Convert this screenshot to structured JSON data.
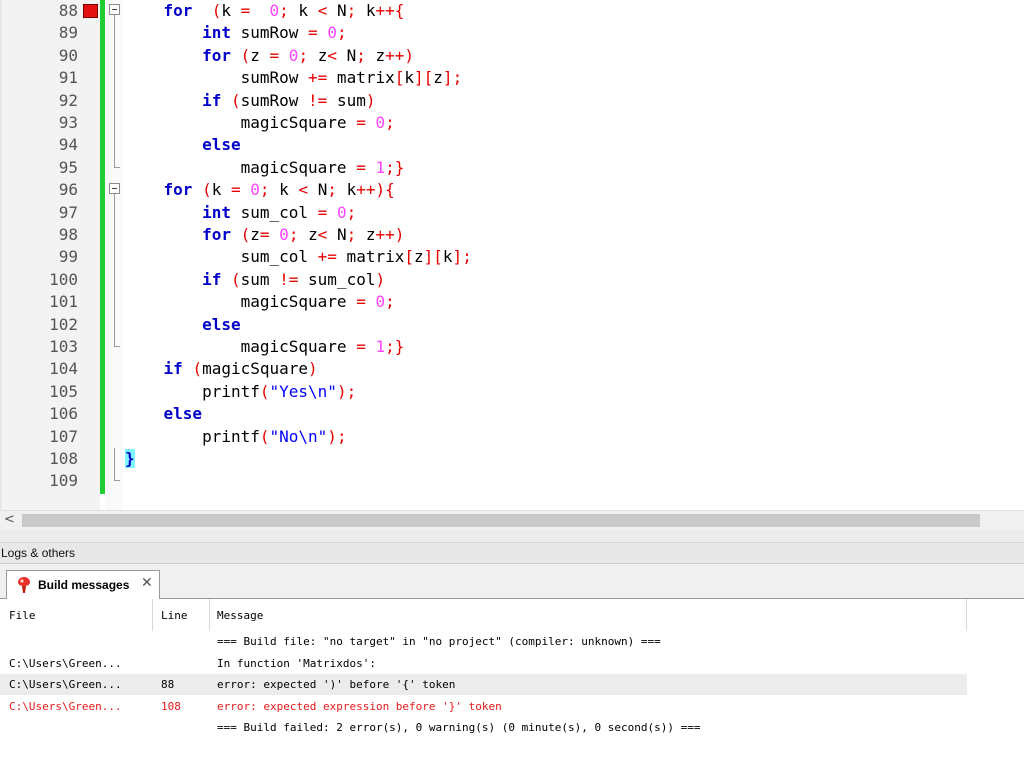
{
  "editor": {
    "lines": [
      {
        "num": "88"
      },
      {
        "num": "89"
      },
      {
        "num": "90"
      },
      {
        "num": "91"
      },
      {
        "num": "92"
      },
      {
        "num": "93"
      },
      {
        "num": "94"
      },
      {
        "num": "95"
      },
      {
        "num": "96"
      },
      {
        "num": "97"
      },
      {
        "num": "98"
      },
      {
        "num": "99"
      },
      {
        "num": "100"
      },
      {
        "num": "101"
      },
      {
        "num": "102"
      },
      {
        "num": "103"
      },
      {
        "num": "104"
      },
      {
        "num": "105"
      },
      {
        "num": "106"
      },
      {
        "num": "107"
      },
      {
        "num": "108"
      },
      {
        "num": "109"
      }
    ],
    "code": [
      [
        [
          "kw",
          "    for"
        ],
        [
          "",
          "  "
        ],
        [
          "op",
          "("
        ],
        [
          "",
          "k "
        ],
        [
          "op",
          "="
        ],
        [
          "",
          "  "
        ],
        [
          "num",
          "0"
        ],
        [
          "op",
          ";"
        ],
        [
          "",
          " k "
        ],
        [
          "op",
          "<"
        ],
        [
          "",
          " N"
        ],
        [
          "op",
          ";"
        ],
        [
          "",
          " k"
        ],
        [
          "op",
          "++"
        ],
        [
          "op",
          "{"
        ]
      ],
      [
        [
          "",
          "        "
        ],
        [
          "kw",
          "int"
        ],
        [
          "",
          " sumRow "
        ],
        [
          "op",
          "="
        ],
        [
          "",
          " "
        ],
        [
          "num",
          "0"
        ],
        [
          "op",
          ";"
        ]
      ],
      [
        [
          "",
          "        "
        ],
        [
          "kw",
          "for"
        ],
        [
          "",
          " "
        ],
        [
          "op",
          "("
        ],
        [
          "",
          "z "
        ],
        [
          "op",
          "="
        ],
        [
          "",
          " "
        ],
        [
          "num",
          "0"
        ],
        [
          "op",
          ";"
        ],
        [
          "",
          " z"
        ],
        [
          "op",
          "<"
        ],
        [
          "",
          " N"
        ],
        [
          "op",
          ";"
        ],
        [
          "",
          " z"
        ],
        [
          "op",
          "++"
        ],
        [
          "op",
          ")"
        ]
      ],
      [
        [
          "",
          "            sumRow "
        ],
        [
          "op",
          "+="
        ],
        [
          "",
          " matrix"
        ],
        [
          "op",
          "["
        ],
        [
          "",
          "k"
        ],
        [
          "op",
          "]["
        ],
        [
          "",
          "z"
        ],
        [
          "op",
          "]"
        ],
        [
          "op",
          ";"
        ]
      ],
      [
        [
          "",
          "        "
        ],
        [
          "kw",
          "if"
        ],
        [
          "",
          " "
        ],
        [
          "op",
          "("
        ],
        [
          "",
          "sumRow "
        ],
        [
          "op",
          "!="
        ],
        [
          "",
          " sum"
        ],
        [
          "op",
          ")"
        ]
      ],
      [
        [
          "",
          "            magicSquare "
        ],
        [
          "op",
          "="
        ],
        [
          "",
          " "
        ],
        [
          "num",
          "0"
        ],
        [
          "op",
          ";"
        ]
      ],
      [
        [
          "kw",
          "        else"
        ]
      ],
      [
        [
          "",
          "            magicSquare "
        ],
        [
          "op",
          "="
        ],
        [
          "",
          " "
        ],
        [
          "num",
          "1"
        ],
        [
          "op",
          ";}"
        ]
      ],
      [
        [
          "kw",
          "    for"
        ],
        [
          "",
          " "
        ],
        [
          "op",
          "("
        ],
        [
          "",
          "k "
        ],
        [
          "op",
          "="
        ],
        [
          "",
          " "
        ],
        [
          "num",
          "0"
        ],
        [
          "op",
          ";"
        ],
        [
          "",
          " k "
        ],
        [
          "op",
          "<"
        ],
        [
          "",
          " N"
        ],
        [
          "op",
          ";"
        ],
        [
          "",
          " k"
        ],
        [
          "op",
          "++)"
        ],
        [
          "op",
          "{"
        ]
      ],
      [
        [
          "",
          "        "
        ],
        [
          "kw",
          "int"
        ],
        [
          "",
          " sum_col "
        ],
        [
          "op",
          "="
        ],
        [
          "",
          " "
        ],
        [
          "num",
          "0"
        ],
        [
          "op",
          ";"
        ]
      ],
      [
        [
          "",
          "        "
        ],
        [
          "kw",
          "for"
        ],
        [
          "",
          " "
        ],
        [
          "op",
          "("
        ],
        [
          "",
          "z"
        ],
        [
          "op",
          "="
        ],
        [
          "",
          " "
        ],
        [
          "num",
          "0"
        ],
        [
          "op",
          ";"
        ],
        [
          "",
          " z"
        ],
        [
          "op",
          "<"
        ],
        [
          "",
          " N"
        ],
        [
          "op",
          ";"
        ],
        [
          "",
          " z"
        ],
        [
          "op",
          "++)"
        ]
      ],
      [
        [
          "",
          "            sum_col "
        ],
        [
          "op",
          "+="
        ],
        [
          "",
          " matrix"
        ],
        [
          "op",
          "["
        ],
        [
          "",
          "z"
        ],
        [
          "op",
          "]["
        ],
        [
          "",
          "k"
        ],
        [
          "op",
          "]"
        ],
        [
          "op",
          ";"
        ]
      ],
      [
        [
          "",
          "        "
        ],
        [
          "kw",
          "if"
        ],
        [
          "",
          " "
        ],
        [
          "op",
          "("
        ],
        [
          "",
          "sum "
        ],
        [
          "op",
          "!="
        ],
        [
          "",
          " sum_col"
        ],
        [
          "op",
          ")"
        ]
      ],
      [
        [
          "",
          "            magicSquare "
        ],
        [
          "op",
          "="
        ],
        [
          "",
          " "
        ],
        [
          "num",
          "0"
        ],
        [
          "op",
          ";"
        ]
      ],
      [
        [
          "kw",
          "        else"
        ]
      ],
      [
        [
          "",
          "            magicSquare "
        ],
        [
          "op",
          "="
        ],
        [
          "",
          " "
        ],
        [
          "num",
          "1"
        ],
        [
          "op",
          ";}"
        ]
      ],
      [
        [
          "kw",
          "    if"
        ],
        [
          "",
          " "
        ],
        [
          "op",
          "("
        ],
        [
          "",
          "magicSquare"
        ],
        [
          "op",
          ")"
        ]
      ],
      [
        [
          "",
          "        printf"
        ],
        [
          "op",
          "("
        ],
        [
          "str",
          "\"Yes\\n\""
        ],
        [
          "op",
          ")"
        ],
        [
          "op",
          ";"
        ]
      ],
      [
        [
          "kw",
          "    else"
        ]
      ],
      [
        [
          "",
          "        printf"
        ],
        [
          "op",
          "("
        ],
        [
          "str",
          "\"No\\n\""
        ],
        [
          "op",
          ")"
        ],
        [
          "op",
          ";"
        ]
      ],
      [
        [
          "brace",
          "}"
        ]
      ],
      []
    ]
  },
  "logs": {
    "panel_title": "Logs & others",
    "tab_label": "Build messages",
    "tab_close": "✕",
    "columns": {
      "file": "File",
      "line": "Line",
      "message": "Message"
    },
    "rows": [
      {
        "file": "",
        "line": "",
        "message": "=== Build file: \"no target\" in \"no project\" (compiler: unknown) ===",
        "style": ""
      },
      {
        "file": "C:\\Users\\Green...",
        "line": "",
        "message": "In function 'Matrixdos':",
        "style": ""
      },
      {
        "file": "C:\\Users\\Green...",
        "line": "88",
        "message": "error: expected ')' before '{' token",
        "style": "alt"
      },
      {
        "file": "C:\\Users\\Green...",
        "line": "108",
        "message": "error: expected expression before '}' token",
        "style": "err"
      },
      {
        "file": "",
        "line": "",
        "message": "=== Build failed: 2 error(s), 0 warning(s) (0 minute(s), 0 second(s)) ===",
        "style": ""
      }
    ]
  },
  "scrollbar": {
    "left_arrow": "<"
  },
  "colors": {
    "keyword": "#0000c8",
    "number": "#ff44ff",
    "operator": "#e60000",
    "string": "#0000ff",
    "breakpoint": "#e41111",
    "change_bar": "#22cc33",
    "error_text": "#e41a1a"
  },
  "icons": {
    "breakpoint": "breakpoint-marker",
    "fold": "fold-toggle-icon",
    "tab": "build-messages-icon"
  }
}
